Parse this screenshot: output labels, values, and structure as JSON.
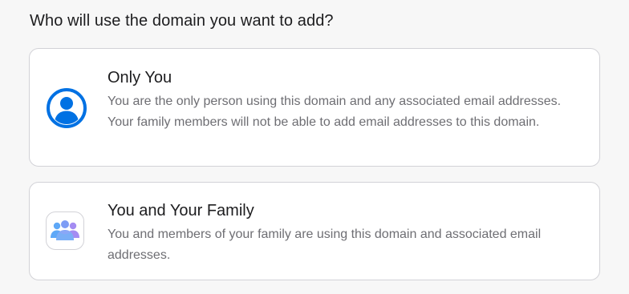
{
  "question": "Who will use the domain you want to add?",
  "options": [
    {
      "title": "Only You",
      "description": "You are the only person using this domain and any associated email addresses. Your family members will not be able to add email addresses to this domain.",
      "icon": "person-circle-icon"
    },
    {
      "title": "You and Your Family",
      "description": "You and members of your family are using this domain and associated email addresses.",
      "icon": "family-icon"
    }
  ],
  "colors": {
    "accent": "#0071e3",
    "family_icon_blue": "#5ea8f7",
    "family_icon_purple": "#a48cf2"
  }
}
